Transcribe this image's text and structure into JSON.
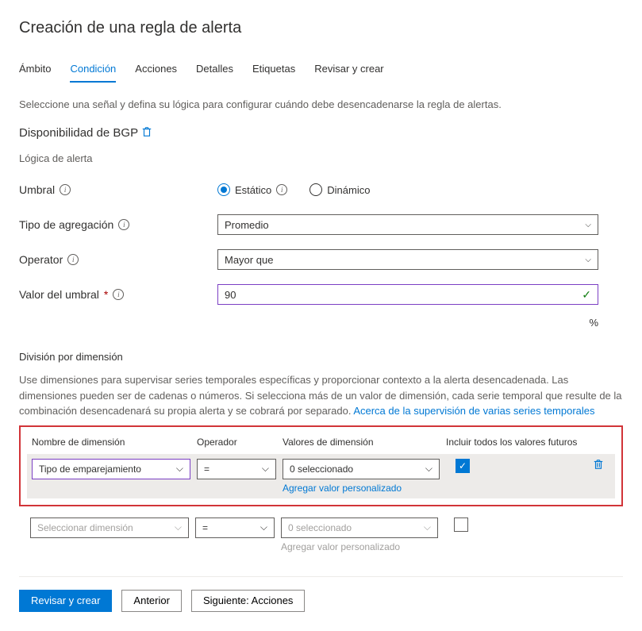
{
  "page_title": "Creación de una regla de alerta",
  "tabs": [
    "Ámbito",
    "Condición",
    "Acciones",
    "Detalles",
    "Etiquetas",
    "Revisar y crear"
  ],
  "active_tab_index": 1,
  "intro_desc": "Seleccione una señal y defina su lógica para configurar cuándo debe desencadenarse la regla de alertas.",
  "signal_name": "Disponibilidad de BGP",
  "logic_section_label": "Lógica de alerta",
  "threshold": {
    "label": "Umbral",
    "options": [
      "Estático",
      "Dinámico"
    ],
    "selected_index": 0
  },
  "aggregation": {
    "label": "Tipo de agregación",
    "value": "Promedio"
  },
  "operator": {
    "label": "Operator",
    "value": "Mayor que"
  },
  "threshold_value": {
    "label": "Valor del umbral",
    "value": "90",
    "suffix": "%"
  },
  "dimension_section": {
    "title": "División por dimensión",
    "desc_part1": "Use dimensiones para supervisar series temporales específicas y proporcionar contexto a la alerta desencadenada. Las dimensiones pueden ser de cadenas o números. Si selecciona más de un valor de dimensión, cada serie temporal que resulte de la combinación desencadenará su propia alerta y se cobrará por separado. ",
    "desc_link": "Acerca de la supervisión de varias series temporales",
    "headers": {
      "name": "Nombre de dimensión",
      "operator": "Operador",
      "values": "Valores de dimensión",
      "include": "Incluir todos los valores futuros"
    },
    "rows": [
      {
        "name": "Tipo de emparejamiento",
        "operator": "=",
        "value": "0 seleccionado",
        "add_custom": "Agregar valor personalizado",
        "checked": true,
        "highlighted": true
      },
      {
        "name": "Seleccionar dimensión",
        "operator": "=",
        "value": "0 seleccionado",
        "add_custom": "Agregar valor personalizado",
        "checked": false,
        "highlighted": false
      }
    ]
  },
  "footer": {
    "review": "Revisar y crear",
    "previous": "Anterior",
    "next": "Siguiente: Acciones"
  }
}
